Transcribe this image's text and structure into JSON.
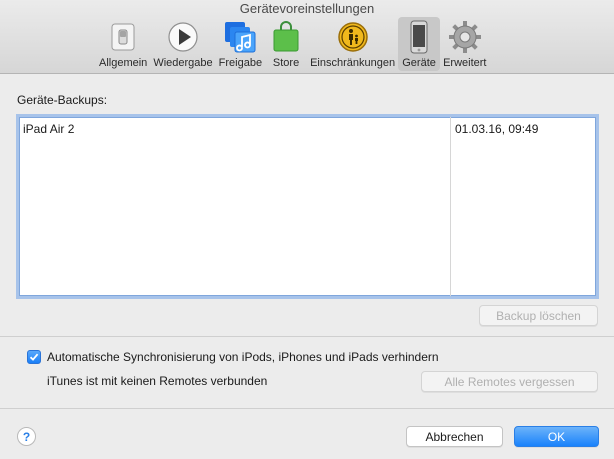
{
  "window": {
    "title": "Gerätevoreinstellungen"
  },
  "toolbar": {
    "items": [
      {
        "label": "Allgemein",
        "icon": "switch-icon"
      },
      {
        "label": "Wiedergabe",
        "icon": "play-icon"
      },
      {
        "label": "Freigabe",
        "icon": "music-sharing-icon"
      },
      {
        "label": "Store",
        "icon": "shopping-bag-icon"
      },
      {
        "label": "Einschränkungen",
        "icon": "parental-icon"
      },
      {
        "label": "Geräte",
        "icon": "iphone-icon",
        "selected": true
      },
      {
        "label": "Erweitert",
        "icon": "gear-icon"
      }
    ]
  },
  "backups": {
    "section_label": "Geräte-Backups:",
    "rows": [
      {
        "name": "iPad Air 2",
        "date": "01.03.16, 09:49"
      }
    ],
    "delete_button": "Backup löschen"
  },
  "options": {
    "prevent_sync_label": "Automatische Synchronisierung von iPods, iPhones und iPads verhindern",
    "prevent_sync_checked": true,
    "remotes_status": "iTunes ist mit keinen Remotes verbunden",
    "forget_remotes_button": "Alle Remotes vergessen"
  },
  "footer": {
    "help_label": "?",
    "cancel_button": "Abbrechen",
    "ok_button": "OK"
  },
  "colors": {
    "accent": "#1a82fb",
    "selection_border": "#a7c3ea"
  }
}
